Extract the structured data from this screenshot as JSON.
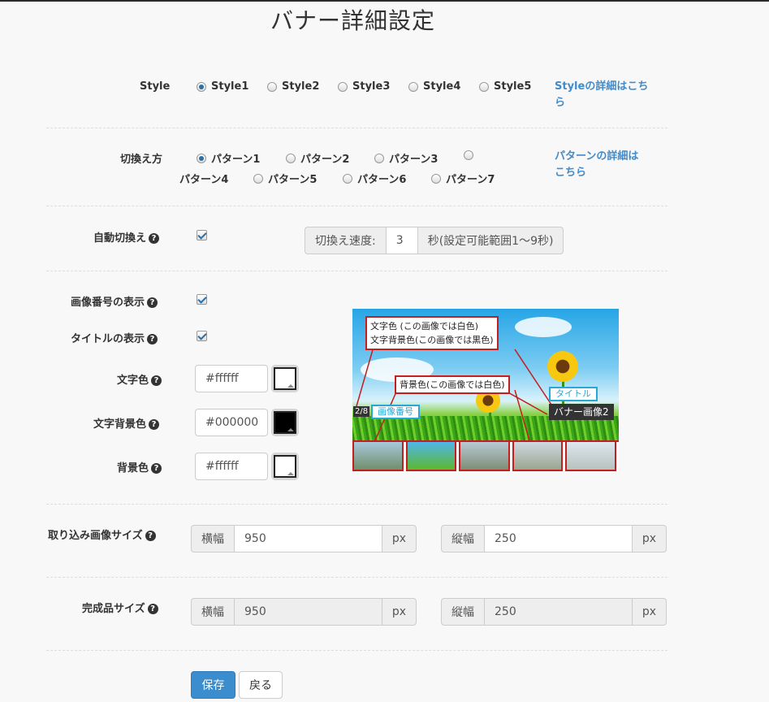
{
  "page": {
    "title": "バナー詳細設定"
  },
  "style": {
    "label": "Style",
    "options": [
      "Style1",
      "Style2",
      "Style3",
      "Style4",
      "Style5"
    ],
    "selected": "Style1",
    "detail_link_line1": "Styleの詳細はこち",
    "detail_link_line2": "ら"
  },
  "switch_method": {
    "label": "切換え方",
    "options": [
      "パターン1",
      "パターン2",
      "パターン3",
      "パターン4",
      "パターン5",
      "パターン6",
      "パターン7"
    ],
    "selected": "パターン1",
    "detail_link_line1": "パターンの詳細は",
    "detail_link_line2": "こちら"
  },
  "auto_switch": {
    "label": "自動切換え",
    "checked": true,
    "speed_label": "切換え速度:",
    "speed_value": "3",
    "speed_unit": "秒(設定可能範囲1〜9秒)"
  },
  "show_image_number": {
    "label": "画像番号の表示",
    "checked": true
  },
  "show_title": {
    "label": "タイトルの表示",
    "checked": true
  },
  "text_color": {
    "label": "文字色",
    "value": "#ffffff",
    "swatch": "#ffffff"
  },
  "text_bg_color": {
    "label": "文字背景色",
    "value": "#000000",
    "swatch": "#000000"
  },
  "bg_color": {
    "label": "背景色",
    "value": "#ffffff",
    "swatch": "#ffffff"
  },
  "import_size": {
    "label": "取り込み画像サイズ",
    "width_label": "横幅",
    "width_value": "950",
    "width_unit": "px",
    "height_label": "縦幅",
    "height_value": "250",
    "height_unit": "px"
  },
  "final_size": {
    "label": "完成品サイズ",
    "width_label": "横幅",
    "width_value": "950",
    "width_unit": "px",
    "height_label": "縦幅",
    "height_value": "250",
    "height_unit": "px"
  },
  "preview": {
    "callout_text_color": "文字色 (この画像では白色)",
    "callout_text_bg": "文字背景色(この画像では黒色)",
    "callout_bg": "背景色(この画像では白色)",
    "title_tag": "タイトル",
    "number_tag": "画像番号",
    "number_badge": "2/8",
    "banner_title": "バナー画像2"
  },
  "buttons": {
    "save": "保存",
    "back": "戻る"
  },
  "colors": {
    "accent": "#428bca",
    "primary_button": "#3c8dcd",
    "callout_border": "#c41e1e",
    "tag_border": "#29a7d6"
  },
  "icons": {
    "help": "question-circle-icon",
    "color_picker": "color-picker-icon"
  }
}
